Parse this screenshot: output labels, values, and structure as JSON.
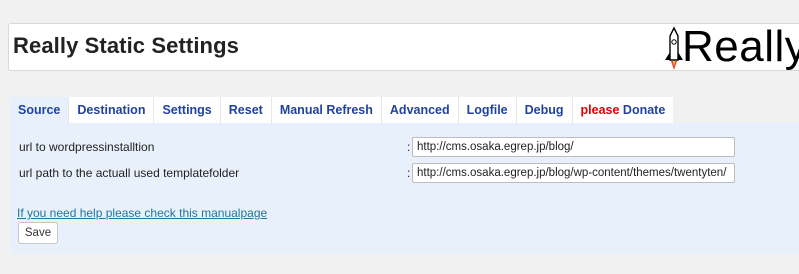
{
  "header": {
    "title": "Really Static Settings",
    "logo_text": "Really"
  },
  "tabs": [
    {
      "label": "Source",
      "active": true
    },
    {
      "label": "Destination"
    },
    {
      "label": "Settings"
    },
    {
      "label": "Reset"
    },
    {
      "label": "Manual Refresh"
    },
    {
      "label": "Advanced"
    },
    {
      "label": "Logfile"
    },
    {
      "label": "Debug"
    },
    {
      "label_please": "please",
      "label": "Donate"
    }
  ],
  "form": {
    "rows": [
      {
        "label": "url to wordpressinstalltion",
        "colon": ":",
        "value": "http://cms.osaka.egrep.jp/blog/"
      },
      {
        "label": "url path to the actuall used templatefolder",
        "colon": ":",
        "value": "http://cms.osaka.egrep.jp/blog/wp-content/themes/twentyten/"
      }
    ],
    "help_link": "If you need help please check this manualpage",
    "save_label": "Save"
  },
  "colors": {
    "tab_text": "#21439b",
    "please_text": "#e10000",
    "panel_bg": "#e8f1fb",
    "link": "#21759b"
  }
}
